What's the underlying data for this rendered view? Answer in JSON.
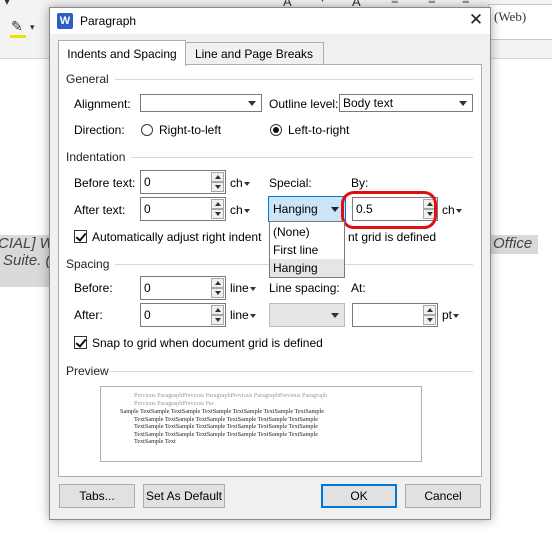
{
  "background": {
    "web_tab": "(Web)",
    "text_left": [
      "CIAL] W",
      "Suite. ("
    ],
    "text_right": "Office"
  },
  "dialog": {
    "title": "Paragraph",
    "app_icon_letter": "W",
    "tabs": [
      "Indents and Spacing",
      "Line and Page Breaks"
    ],
    "active_tab": 0
  },
  "general": {
    "header": "General",
    "alignment_label": "Alignment:",
    "alignment_value": "",
    "outline_label": "Outline level:",
    "outline_value": "Body text",
    "direction_label": "Direction:",
    "rtl_label": "Right-to-left",
    "ltr_label": "Left-to-right",
    "direction_selected": "ltr"
  },
  "indentation": {
    "header": "Indentation",
    "before_label": "Before text:",
    "before_value": "0",
    "before_unit": "ch",
    "after_label": "After text:",
    "after_value": "0",
    "after_unit": "ch",
    "special_label": "Special:",
    "special_value": "Hanging",
    "special_options": [
      "(None)",
      "First line",
      "Hanging"
    ],
    "by_label": "By:",
    "by_value": "0.5",
    "by_unit": "ch",
    "auto_adjust_label": "Automatically adjust right indent",
    "auto_adjust_tail": "nt grid is defined",
    "auto_adjust_checked": true
  },
  "spacing": {
    "header": "Spacing",
    "before_label": "Before:",
    "before_value": "0",
    "before_unit": "line",
    "after_label": "After:",
    "after_value": "0",
    "after_unit": "line",
    "line_spacing_label": "Line spacing:",
    "line_spacing_value": "",
    "at_label": "At:",
    "at_value": "",
    "at_unit": "pt",
    "snap_label": "Snap to grid when document grid is defined",
    "snap_checked": true
  },
  "preview": {
    "header": "Preview",
    "previous_lines": [
      "Previous ParagraphPrevious ParagraphPrevious ParagraphPrevious Paragraph",
      "Previous ParagraphPrevious Par"
    ],
    "sample_lines": [
      "Sample TextSample TextSample TextSample TextSample TextSample TextSample",
      "TextSample TextSample TextSample TextSample TextSample TextSample",
      "TextSample TextSample TextSample TextSample TextSample TextSample",
      "TextSample TextSample TextSample TextSample TextSample TextSample",
      "TextSample Text"
    ]
  },
  "buttons": {
    "tabs": "Tabs...",
    "set_default": "Set As Default",
    "ok": "OK",
    "cancel": "Cancel"
  },
  "colors": {
    "highlight_ring": "#e01010",
    "focus_blue": "#0078d7",
    "selection_fill": "#cce4f7",
    "dialog_bg": "#f0f0f0"
  }
}
